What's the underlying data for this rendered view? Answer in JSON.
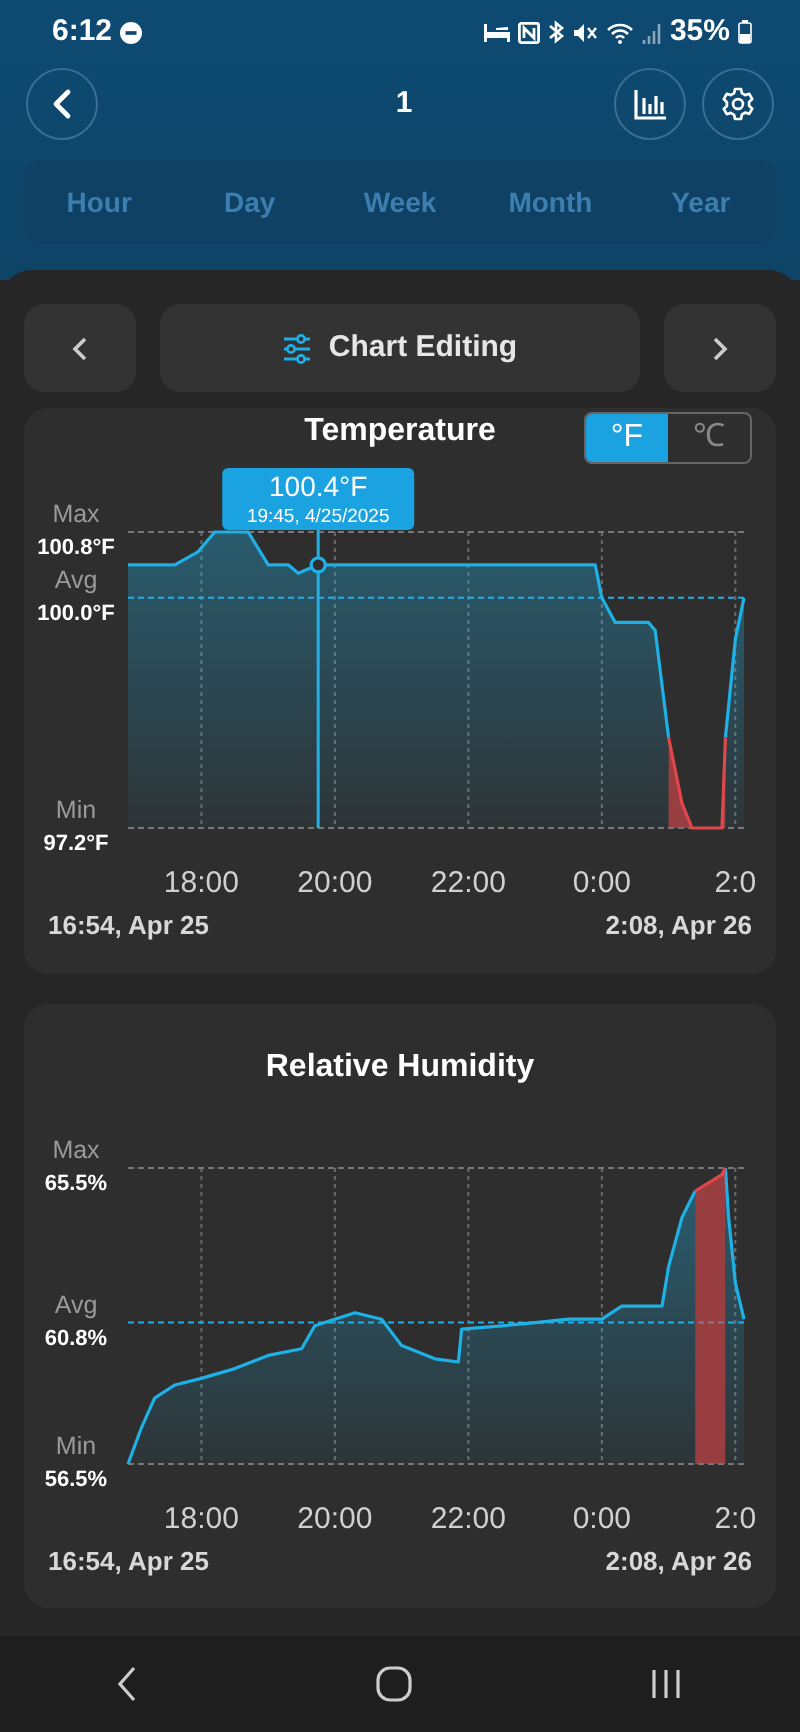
{
  "status_bar": {
    "time": "6:12",
    "battery": "35%"
  },
  "header": {
    "title": "1"
  },
  "periods": [
    {
      "label": "Hour",
      "selected": false
    },
    {
      "label": "Day",
      "selected": false
    },
    {
      "label": "Week",
      "selected": false
    },
    {
      "label": "Month",
      "selected": false
    },
    {
      "label": "Year",
      "selected": false
    }
  ],
  "chart_nav": {
    "label": "Chart Editing"
  },
  "cards": [
    {
      "title": "Temperature",
      "units": [
        {
          "label": "°F",
          "selected": true
        },
        {
          "label": "℃",
          "selected": false
        }
      ],
      "y_captions": [
        "Max",
        "Avg",
        "Min"
      ],
      "range_start": "16:54, Apr 25",
      "range_end": "2:08, Apr 26",
      "chart_data": {
        "type": "area",
        "x": [
          16.9,
          17.6,
          17.95,
          18.2,
          18.7,
          19.0,
          19.3,
          19.45,
          19.75,
          21.0,
          23.0,
          23.9,
          24.0,
          24.2,
          24.7,
          24.8,
          25.0,
          25.2,
          25.35,
          25.8,
          25.85,
          26.0,
          26.13
        ],
        "series": [
          {
            "color": "#1fb0e6",
            "values": [
              100.4,
              100.4,
              100.56,
              100.8,
              100.8,
              100.4,
              100.4,
              100.3,
              100.4,
              100.4,
              100.4,
              100.4,
              100.0,
              99.7,
              99.7,
              99.6,
              98.3,
              null,
              null,
              null,
              98.3,
              99.5,
              100.0
            ]
          },
          {
            "color": "#e0474c",
            "values": [
              null,
              null,
              null,
              null,
              null,
              null,
              null,
              null,
              null,
              null,
              null,
              null,
              null,
              null,
              null,
              null,
              98.3,
              97.5,
              97.2,
              97.2,
              98.3,
              null,
              null
            ]
          }
        ],
        "xlim": [
          16.9,
          26.13
        ],
        "ylim": [
          97.2,
          100.8
        ],
        "grid": true,
        "ref_lines": [
          {
            "axis": "y",
            "value": 100.0,
            "color": "#1fb0e6"
          },
          {
            "axis": "x",
            "value": 19.75,
            "color": "#1fb0e6"
          }
        ],
        "xticks": [
          {
            "value": 18,
            "label": "18:00"
          },
          {
            "value": 20,
            "label": "20:00"
          },
          {
            "value": 22,
            "label": "22:00"
          },
          {
            "value": 24,
            "label": "0:00"
          },
          {
            "value": 26,
            "label": "2:0"
          }
        ],
        "yticks": [
          {
            "value": 100.8,
            "label": "100.8°F"
          },
          {
            "value": 100.0,
            "label": "100.0°F"
          },
          {
            "value": 97.2,
            "label": "97.2°F"
          }
        ],
        "annotations": [
          {
            "x": 19.75,
            "y": 100.4,
            "text": "100.4°F"
          },
          {
            "x": 19.75,
            "y": 100.4,
            "text": "19:45, 4/25/2025"
          }
        ]
      }
    },
    {
      "title": "Relative Humidity",
      "y_captions": [
        "Max",
        "Avg",
        "Min"
      ],
      "range_start": "16:54, Apr 25",
      "range_end": "2:08, Apr 26",
      "chart_data": {
        "type": "area",
        "x": [
          16.9,
          17.1,
          17.3,
          17.6,
          18.0,
          18.5,
          19.0,
          19.5,
          19.7,
          20.0,
          20.3,
          20.7,
          21.0,
          21.5,
          21.85,
          21.9,
          22.5,
          23.0,
          23.5,
          24.0,
          24.3,
          24.9,
          25.0,
          25.2,
          25.4,
          25.8,
          25.85,
          25.9,
          26.0,
          26.13
        ],
        "series": [
          {
            "color": "#1fb0e6",
            "values": [
              56.5,
              57.6,
              58.5,
              58.9,
              59.1,
              59.4,
              59.8,
              60.0,
              60.7,
              60.9,
              61.1,
              60.9,
              60.1,
              59.7,
              59.6,
              60.6,
              60.7,
              60.8,
              60.9,
              60.9,
              61.3,
              61.3,
              62.5,
              64.0,
              64.8,
              null,
              65.5,
              64.0,
              62.0,
              60.9
            ]
          },
          {
            "color": "#e0474c",
            "values": [
              null,
              null,
              null,
              null,
              null,
              null,
              null,
              null,
              null,
              null,
              null,
              null,
              null,
              null,
              null,
              null,
              null,
              null,
              null,
              null,
              null,
              null,
              null,
              null,
              64.8,
              65.3,
              65.5,
              null,
              null,
              null
            ]
          }
        ],
        "xlim": [
          16.9,
          26.13
        ],
        "ylim": [
          56.5,
          65.5
        ],
        "grid": true,
        "ref_lines": [
          {
            "axis": "y",
            "value": 60.8,
            "color": "#1fb0e6"
          }
        ],
        "xticks": [
          {
            "value": 18,
            "label": "18:00"
          },
          {
            "value": 20,
            "label": "20:00"
          },
          {
            "value": 22,
            "label": "22:00"
          },
          {
            "value": 24,
            "label": "0:00"
          },
          {
            "value": 26,
            "label": "2:0"
          }
        ],
        "yticks": [
          {
            "value": 65.5,
            "label": "65.5%"
          },
          {
            "value": 60.8,
            "label": "60.8%"
          },
          {
            "value": 56.5,
            "label": "56.5%"
          }
        ]
      }
    }
  ]
}
